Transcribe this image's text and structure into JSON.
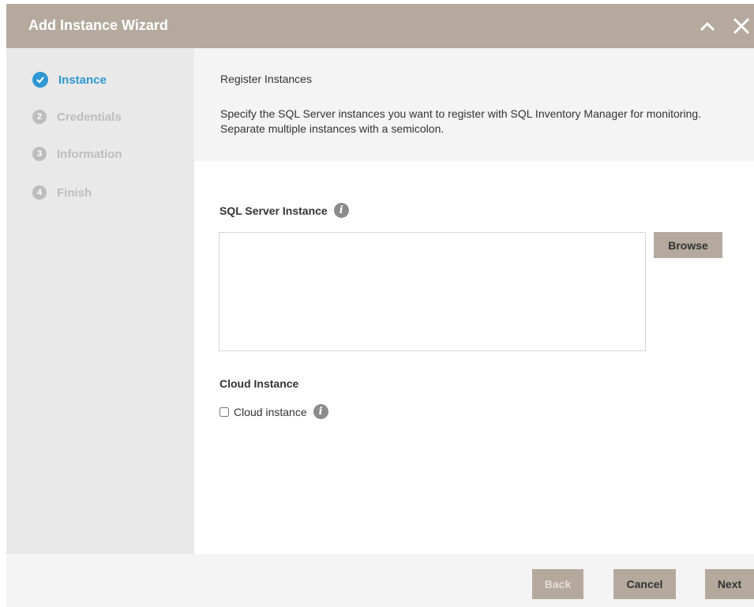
{
  "header": {
    "title": "Add Instance Wizard"
  },
  "steps": [
    {
      "number": "",
      "label": "Instance",
      "state": "active"
    },
    {
      "number": "2",
      "label": "Credentials",
      "state": "pending"
    },
    {
      "number": "3",
      "label": "Information",
      "state": "pending"
    },
    {
      "number": "4",
      "label": "Finish",
      "state": "pending"
    }
  ],
  "intro": {
    "title": "Register Instances",
    "description": "Specify the SQL Server instances you want to register with SQL Inventory Manager for monitoring. Separate multiple instances with a semicolon."
  },
  "form": {
    "sql_label": "SQL Server Instance",
    "sql_value": "",
    "browse_label": "Browse",
    "cloud_section_label": "Cloud Instance",
    "cloud_checkbox_label": "Cloud instance",
    "cloud_checked": false,
    "info_glyph": "i"
  },
  "footer": {
    "back_label": "Back",
    "cancel_label": "Cancel",
    "next_label": "Next"
  },
  "colors": {
    "accent": "#2f97d2",
    "header_bg": "#b5a99e",
    "button_bg": "#b5a99e"
  },
  "icons": {
    "collapse": "chevron-up-icon",
    "close": "close-icon",
    "step_done": "check-icon",
    "info": "info-icon"
  }
}
